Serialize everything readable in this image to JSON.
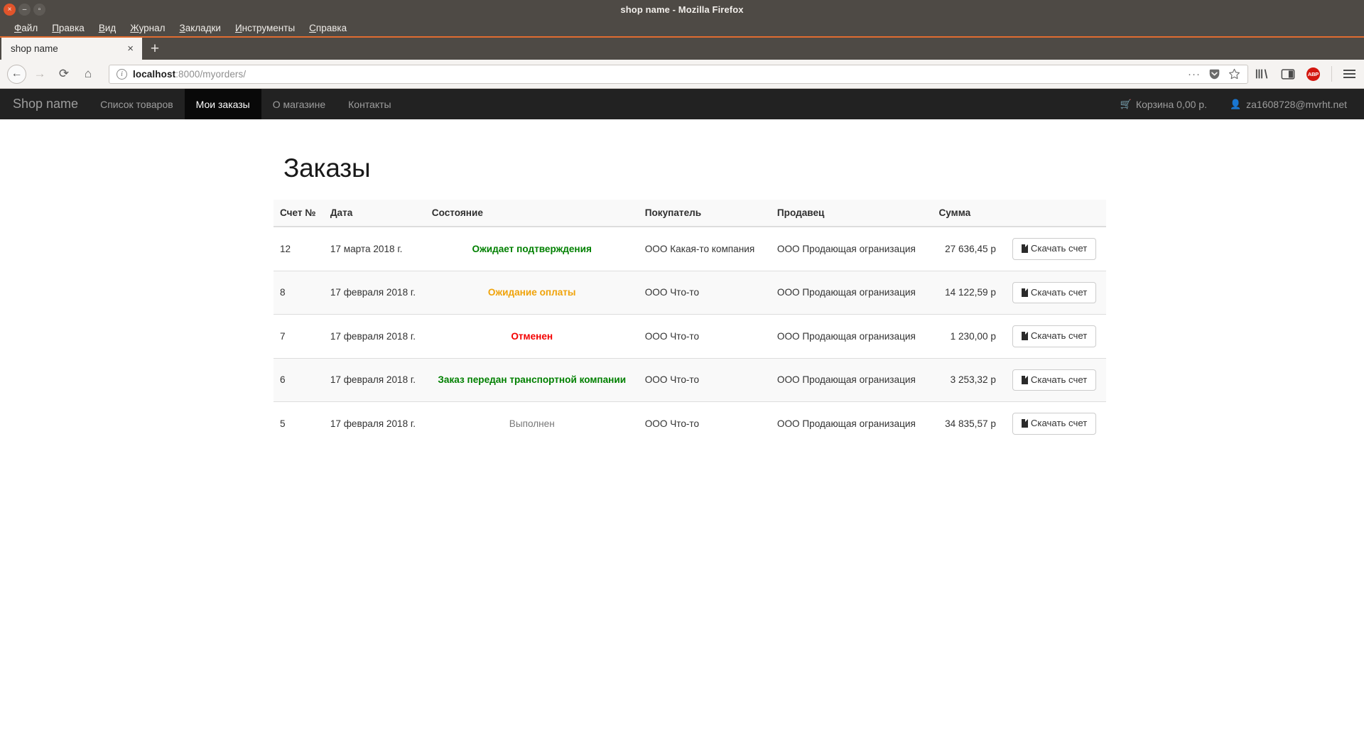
{
  "window": {
    "title": "shop name - Mozilla Firefox",
    "controls": {
      "close": "×",
      "minimize": "–",
      "maximize": "▫"
    }
  },
  "menubar": [
    {
      "label": "Файл",
      "accel": "Ф"
    },
    {
      "label": "Правка",
      "accel": "П"
    },
    {
      "label": "Вид",
      "accel": "В"
    },
    {
      "label": "Журнал",
      "accel": "Ж"
    },
    {
      "label": "Закладки",
      "accel": "З"
    },
    {
      "label": "Инструменты",
      "accel": "И"
    },
    {
      "label": "Справка",
      "accel": "С"
    }
  ],
  "tabs": {
    "items": [
      {
        "label": "shop name",
        "close": "×"
      }
    ],
    "new_tab": "+"
  },
  "toolbar": {
    "back_icon": "←",
    "forward_icon": "→",
    "reload_icon": "⟳",
    "home_icon": "⌂",
    "url_info_icon": "i",
    "url_host": "localhost",
    "url_rest": ":8000/myorders/",
    "page_actions_icon": "···",
    "pocket_icon": "pocket-icon",
    "bookmark_icon": "☆",
    "library_icon": "library-icon",
    "sidebar_icon": "sidebar-icon",
    "adblock_label": "ABP",
    "menu_icon": "hamburger-icon"
  },
  "site_nav": {
    "brand": "Shop name",
    "links": [
      {
        "label": "Список товаров",
        "active": false
      },
      {
        "label": "Мои заказы",
        "active": true
      },
      {
        "label": "О магазине",
        "active": false
      },
      {
        "label": "Контакты",
        "active": false
      }
    ],
    "cart": {
      "icon": "cart-icon",
      "label": "Корзина 0,00 р."
    },
    "user": {
      "icon": "user-icon",
      "label": "za1608728@mvrht.net"
    }
  },
  "page": {
    "title": "Заказы",
    "table": {
      "headers": [
        "Счет №",
        "Дата",
        "Состояние",
        "Покупатель",
        "Продавец",
        "Сумма",
        ""
      ],
      "download_label": "Скачать счет",
      "rows": [
        {
          "num": "12",
          "date": "17 марта 2018 г.",
          "state": "Ожидает подтверждения",
          "state_color": "#008000",
          "state_bold": true,
          "buyer": "ООО Какая-то компания",
          "seller": "ООО Продающая огранизация",
          "sum": "27 636,45 р"
        },
        {
          "num": "8",
          "date": "17 февраля 2018 г.",
          "state": "Ожидание оплаты",
          "state_color": "#f0a30a",
          "state_bold": true,
          "buyer": "ООО Что-то",
          "seller": "ООО Продающая огранизация",
          "sum": "14 122,59 р"
        },
        {
          "num": "7",
          "date": "17 февраля 2018 г.",
          "state": "Отменен",
          "state_color": "#f40000",
          "state_bold": true,
          "buyer": "ООО Что-то",
          "seller": "ООО Продающая огранизация",
          "sum": "1 230,00 р"
        },
        {
          "num": "6",
          "date": "17 февраля 2018 г.",
          "state": "Заказ передан транспортной компании",
          "state_color": "#008000",
          "state_bold": true,
          "buyer": "ООО Что-то",
          "seller": "ООО Продающая огранизация",
          "sum": "3 253,32 р"
        },
        {
          "num": "5",
          "date": "17 февраля 2018 г.",
          "state": "Выполнен",
          "state_color": "#777777",
          "state_bold": false,
          "buyer": "ООО Что-то",
          "seller": "ООО Продающая огранизация",
          "sum": "34 835,57 р"
        }
      ]
    }
  },
  "colors": {
    "chrome_dark": "#4e4a45",
    "accent_orange": "#e06c30",
    "navbar_dark": "#222222",
    "navbar_active": "#090909"
  }
}
